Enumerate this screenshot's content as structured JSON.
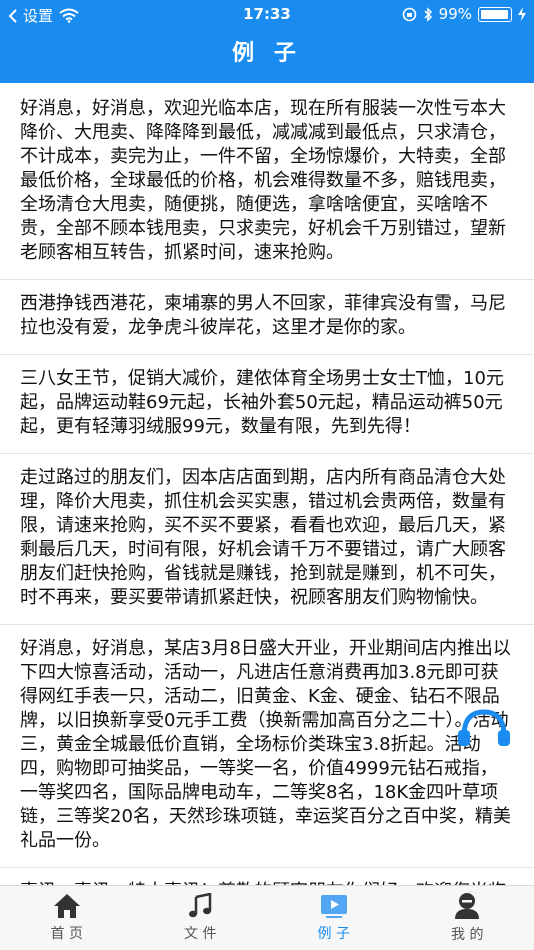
{
  "status_bar": {
    "back_app": "设置",
    "time": "17:33",
    "battery_percent": "99%",
    "battery_level": 0.99
  },
  "nav": {
    "title": "例 子"
  },
  "posts": [
    "好消息，好消息，欢迎光临本店，现在所有服装一次性亏本大降价、大甩卖、降降降到最低，减减减到最低点，只求清仓，不计成本，卖完为止，一件不留，全场惊爆价，大特卖，全部最低价格，全球最低的价格，机会难得数量不多，赔钱甩卖，全场清仓大甩卖，随便挑，随便选，拿啥啥便宜，买啥啥不贵，全部不顾本钱甩卖，只求卖完，好机会千万别错过，望新老顾客相互转告，抓紧时间，速来抢购。",
    "西港挣钱西港花，柬埔寨的男人不回家，菲律宾没有雪，马尼拉也没有爱，龙争虎斗彼岸花，这里才是你的家。",
    "三八女王节，促销大减价，建侬体育全场男士女士T恤，10元起，品牌运动鞋69元起，长袖外套50元起，精品运动裤50元起，更有轻薄羽绒服99元，数量有限，先到先得！",
    "走过路过的朋友们，因本店店面到期，店内所有商品清仓大处理，降价大甩卖，抓住机会买实惠，错过机会贵两倍，数量有限，请速来抢购，买不买不要紧，看看也欢迎，最后几天，紧剩最后几天，时间有限，好机会请千万不要错过，请广大顾客朋友们赶快抢购，省钱就是赚钱，抢到就是赚到，机不可失，时不再来，要买要带请抓紧赶快，祝顾客朋友们购物愉快。",
    "好消息，好消息，某店3月8日盛大开业，开业期间店内推出以下四大惊喜活动，活动一，凡进店任意消费再加3.8元即可获得网红手表一只，活动二，旧黄金、K金、硬金、钻石不限品牌，以旧换新享受0元手工费（换新需加高百分之二十）。活动三，黄金全城最低价直销，全场标价类珠宝3.8折起。活动四，购物即可抽奖品，一等奖一名，价值4999元钻石戒指，一等奖四名，国际品牌电动车，二等奖8名，18K金四叶草项链，三等奖20名，天然珍珠项链，幸运奖百分之百中奖，精美礼品一份。",
    "喜讯，喜讯，特大喜讯！尊敬的顾客朋友你们好，欢迎您光临本店！本店上百种商品现在厂家直销，我们不计成本，不求回本，但愿卖光！绝好的机会不要错过哦！本店有生活用"
  ],
  "tabs": [
    {
      "label": "首 页",
      "icon": "home-icon",
      "active": false
    },
    {
      "label": "文 件",
      "icon": "music-note-icon",
      "active": false
    },
    {
      "label": "例 子",
      "icon": "video-icon",
      "active": true
    },
    {
      "label": "我 的",
      "icon": "user-icon",
      "active": false
    }
  ],
  "colors": {
    "primary": "#1a8cf0",
    "tab_inactive": "#555555",
    "divider": "#e3e3e3"
  }
}
